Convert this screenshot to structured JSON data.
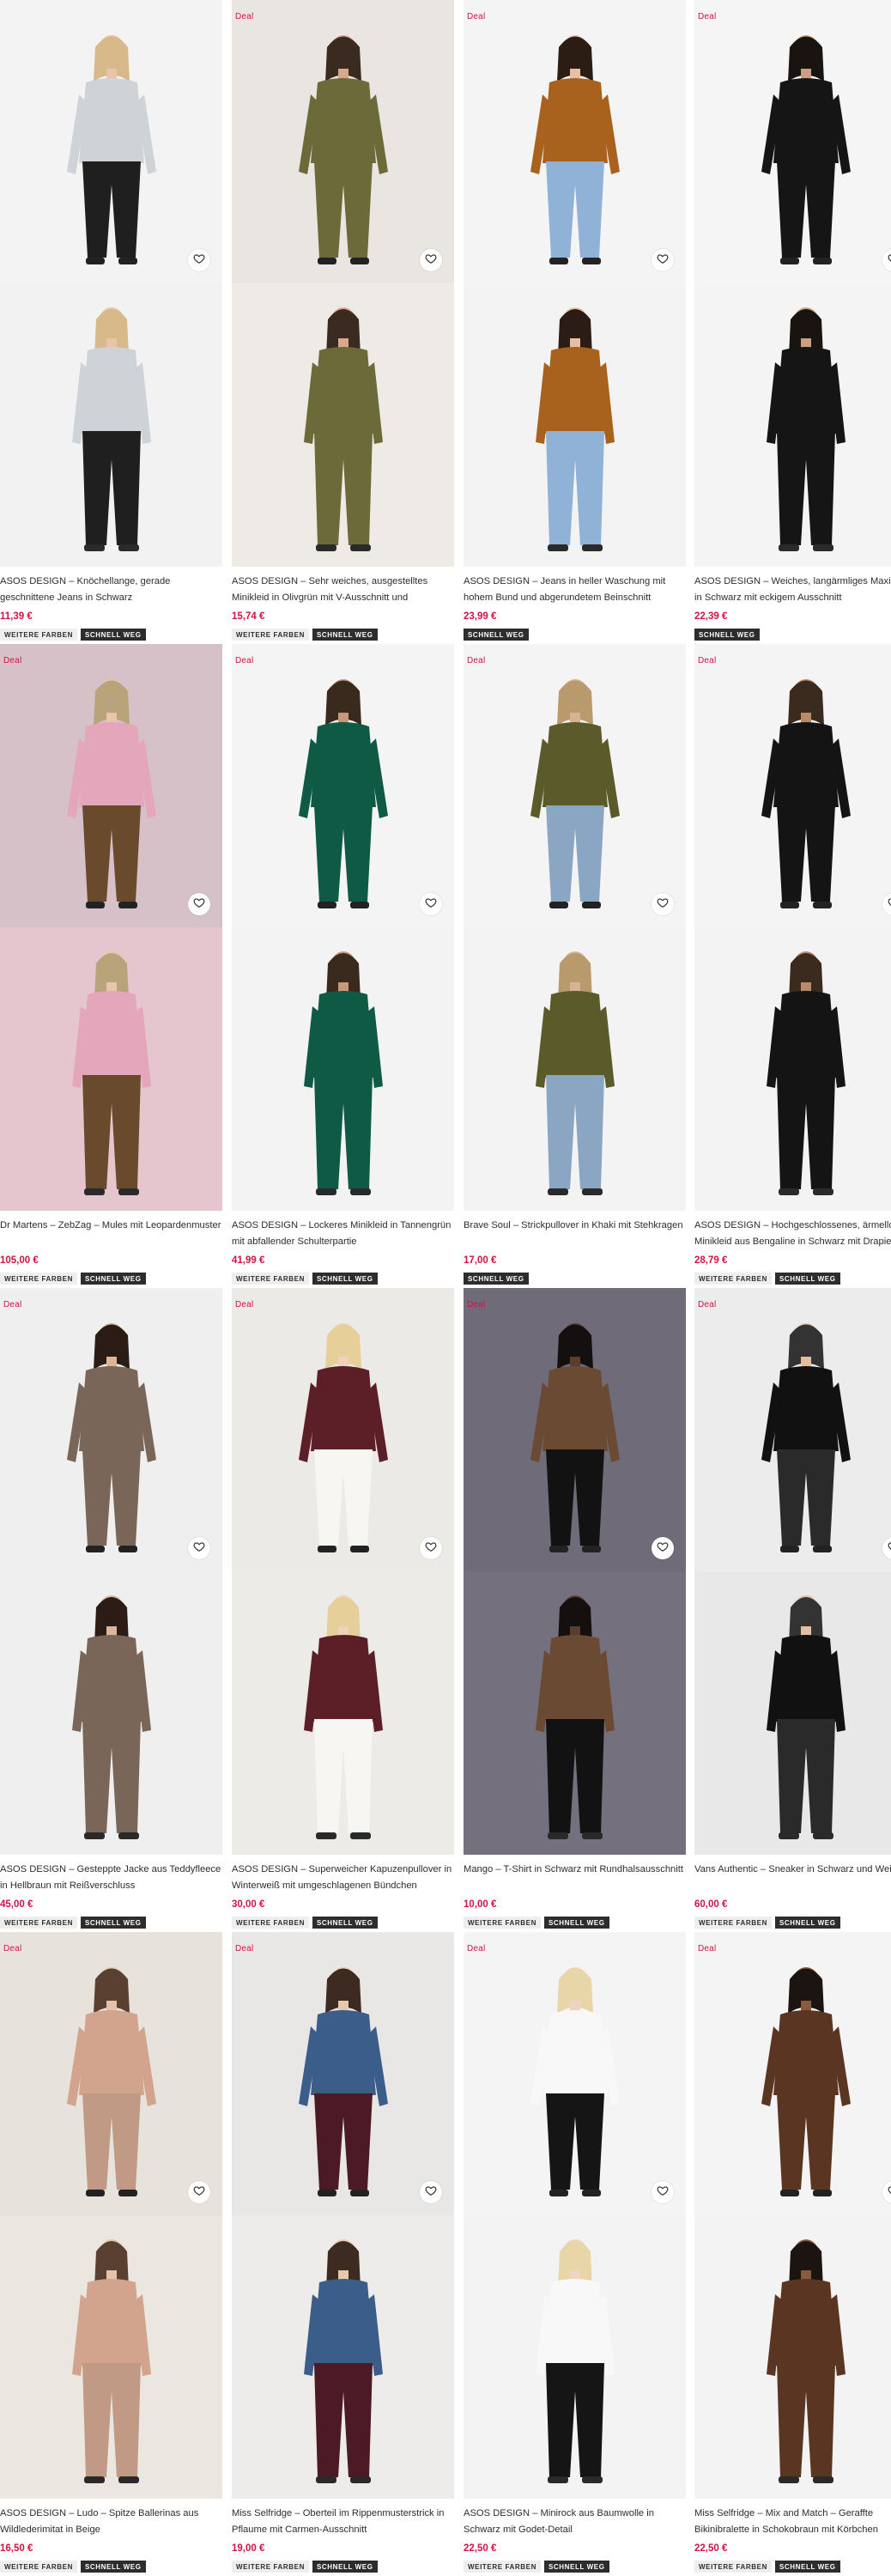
{
  "labels": {
    "deal": "Deal",
    "more_colors": "WEITERE FARBEN",
    "quick_ship": "SCHNELL WEG"
  },
  "products": [
    {
      "title": "ASOS DESIGN – Knöchellange, gerade geschnittene Jeans in Schwarz",
      "price": "11,39 €",
      "deal": false,
      "tags": [
        "more_colors",
        "quick_ship"
      ],
      "palette": {
        "bg_top": "#f3f3f3",
        "bg_bottom": "#f2f2f2",
        "garment": "#1f1f1f",
        "top": "#cfd3d8"
      }
    },
    {
      "title": "ASOS DESIGN – Sehr weiches, ausgestelltes Minikleid in Olivgrün mit V-Ausschnitt und Bindedetail",
      "price": "15,74 €",
      "deal": true,
      "tags": [
        "more_colors",
        "quick_ship"
      ],
      "palette": {
        "bg_top": "#e9e6e1",
        "bg_bottom": "#eeebe6",
        "garment": "#6b6a38",
        "top": "#6b6a38"
      }
    },
    {
      "title": "ASOS DESIGN – Jeans in heller Waschung mit hohem Bund und abgerundetem Beinschnitt",
      "price": "23,99 €",
      "deal": true,
      "tags": [
        "quick_ship"
      ],
      "palette": {
        "bg_top": "#f4f4f4",
        "bg_bottom": "#f3f3f3",
        "garment": "#8fb2d6",
        "top": "#a9621e"
      }
    },
    {
      "title": "ASOS DESIGN – Weiches, langärmliges Maxikleid in Schwarz mit eckigem Ausschnitt",
      "price": "22,39 €",
      "deal": true,
      "tags": [
        "quick_ship"
      ],
      "palette": {
        "bg_top": "#f5f5f5",
        "bg_bottom": "#f4f4f4",
        "garment": "#151515",
        "top": "#151515"
      }
    },
    {
      "title": "Dr Martens – ZebZag – Mules mit Leopardenmuster",
      "price": "105,00 €",
      "deal": true,
      "tags": [
        "more_colors",
        "quick_ship"
      ],
      "palette": {
        "bg_top": "#d7c1c9",
        "bg_bottom": "#e5c6cf",
        "garment": "#6a4a2c",
        "top": "#e3a6bb"
      }
    },
    {
      "title": "ASOS DESIGN – Lockeres Minikleid in Tannengrün mit abfallender Schulterpartie",
      "price": "41,99 €",
      "deal": true,
      "tags": [
        "more_colors",
        "quick_ship"
      ],
      "palette": {
        "bg_top": "#f4f4f4",
        "bg_bottom": "#f3f3f3",
        "garment": "#0e5a44",
        "top": "#0e5a44"
      }
    },
    {
      "title": "Brave Soul – Strickpullover in Khaki mit Stehkragen",
      "price": "17,00 €",
      "deal": true,
      "tags": [
        "quick_ship"
      ],
      "palette": {
        "bg_top": "#f4f4f4",
        "bg_bottom": "#f3f3f3",
        "garment": "#8aa6c3",
        "top": "#5a5a2a"
      }
    },
    {
      "title": "ASOS DESIGN – Hochgeschlossenes, ärmelloses Minikleid aus Bengaline in Schwarz mit Drapierung",
      "price": "28,79 €",
      "deal": true,
      "tags": [
        "more_colors",
        "quick_ship"
      ],
      "palette": {
        "bg_top": "#f4f4f4",
        "bg_bottom": "#f3f3f3",
        "garment": "#141414",
        "top": "#141414"
      }
    },
    {
      "title": "ASOS DESIGN – Gesteppte Jacke aus Teddyfleece in Hellbraun mit Reißverschluss",
      "price": "45,00 €",
      "deal": true,
      "tags": [
        "more_colors",
        "quick_ship"
      ],
      "palette": {
        "bg_top": "#efefef",
        "bg_bottom": "#efefef",
        "garment": "#7a6658",
        "top": "#7a6658"
      }
    },
    {
      "title": "ASOS DESIGN – Superweicher Kapuzenpullover in Winterweiß mit umgeschlagenen Bündchen",
      "price": "30,00 €",
      "deal": true,
      "tags": [
        "more_colors",
        "quick_ship"
      ],
      "palette": {
        "bg_top": "#eceae7",
        "bg_bottom": "#ecebe8",
        "garment": "#f7f6f3",
        "top": "#5c1f27"
      }
    },
    {
      "title": "Mango – T-Shirt in Schwarz mit Rundhalsausschnitt",
      "price": "10,00 €",
      "deal": true,
      "tags": [
        "more_colors",
        "quick_ship"
      ],
      "palette": {
        "bg_top": "#6f6b78",
        "bg_bottom": "#74707d",
        "garment": "#121212",
        "top": "#6a4a32"
      }
    },
    {
      "title": "Vans Authentic – Sneaker in Schwarz und Weiß",
      "price": "60,00 €",
      "deal": true,
      "tags": [
        "more_colors",
        "quick_ship"
      ],
      "palette": {
        "bg_top": "#ececec",
        "bg_bottom": "#e8e8e8",
        "garment": "#2a2a2a",
        "top": "#111111"
      }
    },
    {
      "title": "ASOS DESIGN – Ludo – Spitze Ballerinas aus Wildlederimitat in Beige",
      "price": "16,50 €",
      "deal": true,
      "tags": [
        "more_colors",
        "quick_ship"
      ],
      "palette": {
        "bg_top": "#e8e2dc",
        "bg_bottom": "#ece6e0",
        "garment": "#c09a84",
        "top": "#d2a48d"
      }
    },
    {
      "title": "Miss Selfridge – Oberteil im Rippenmusterstrick in Pflaume mit Carmen-Ausschnitt",
      "price": "19,00 €",
      "deal": true,
      "tags": [
        "more_colors",
        "quick_ship"
      ],
      "palette": {
        "bg_top": "#e9e7e6",
        "bg_bottom": "#eeecea",
        "garment": "#4c1a24",
        "top": "#3b5d8a"
      }
    },
    {
      "title": "ASOS DESIGN – Minirock aus Baumwolle in Schwarz mit Godet-Detail",
      "price": "22,50 €",
      "deal": true,
      "tags": [
        "more_colors",
        "quick_ship"
      ],
      "palette": {
        "bg_top": "#f4f4f4",
        "bg_bottom": "#f3f3f3",
        "garment": "#151515",
        "top": "#f8f8f8"
      }
    },
    {
      "title": "Miss Selfridge – Mix and Match – Geraffte Bikinibralette in Schokobraun mit Körbchen",
      "price": "22,50 €",
      "deal": true,
      "tags": [
        "more_colors",
        "quick_ship"
      ],
      "palette": {
        "bg_top": "#f4f4f4",
        "bg_bottom": "#f3f3f3",
        "garment": "#5a3522",
        "top": "#5a3522"
      }
    }
  ]
}
